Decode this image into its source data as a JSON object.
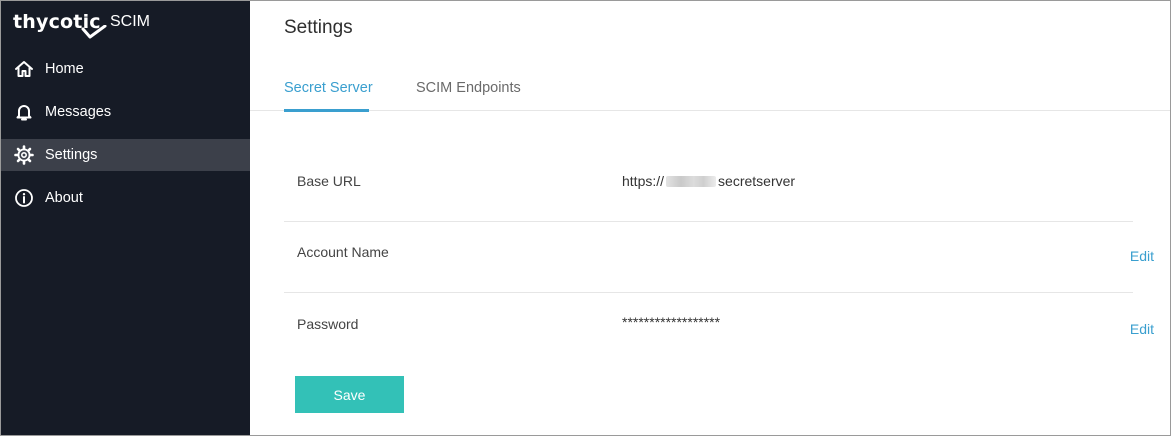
{
  "brand": {
    "logo": "thycotic",
    "app": "SCIM"
  },
  "sidebar": {
    "items": [
      {
        "label": "Home",
        "icon": "home-icon"
      },
      {
        "label": "Messages",
        "icon": "bell-icon"
      },
      {
        "label": "Settings",
        "icon": "gear-icon",
        "active": true
      },
      {
        "label": "About",
        "icon": "info-icon"
      }
    ]
  },
  "main": {
    "title": "Settings",
    "tabs": [
      {
        "label": "Secret Server",
        "active": true
      },
      {
        "label": "SCIM Endpoints",
        "active": false
      }
    ],
    "rows": [
      {
        "label": "Base URL",
        "value_prefix": "https://",
        "value_suffix": "secretserver"
      },
      {
        "label": "Account Name",
        "value": "",
        "action": "Edit"
      },
      {
        "label": "Password",
        "value": "******************",
        "action": "Edit"
      }
    ],
    "save_label": "Save"
  },
  "colors": {
    "sidebar_bg": "#161b26",
    "active_item_bg": "#3c404a",
    "accent": "#3a9fcf",
    "save_button": "#33c1b7"
  }
}
